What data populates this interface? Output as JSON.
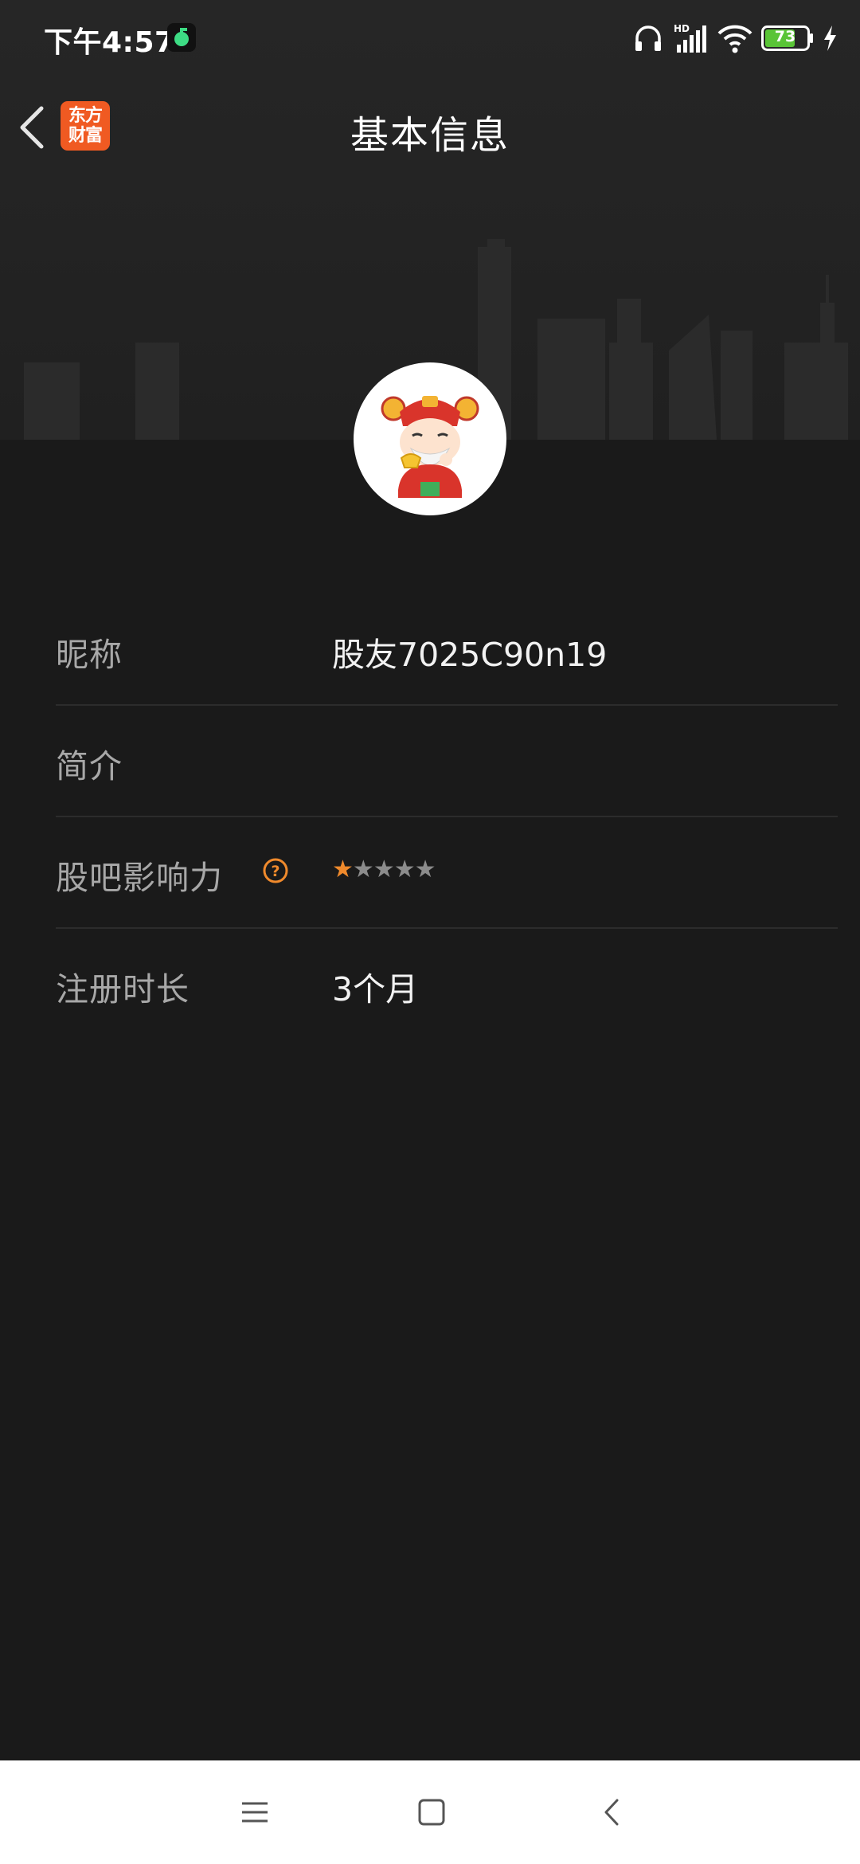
{
  "status_bar": {
    "time": "下午4:57",
    "battery": "73"
  },
  "header": {
    "title": "基本信息",
    "logo_text": "东方财富"
  },
  "profile": {
    "rows": [
      {
        "label": "昵称",
        "value": "股友7025C90n19"
      },
      {
        "label": "简介",
        "value": ""
      },
      {
        "label": "股吧影响力",
        "rating": 1,
        "rating_max": 5
      },
      {
        "label": "注册时长",
        "value": "3个月"
      }
    ]
  },
  "colors": {
    "accent": "#f08a2c",
    "logo_bg": "#f05a22",
    "background": "#1a1a1a"
  },
  "icons": [
    "back-arrow-icon",
    "help-icon",
    "menu-icon",
    "home-icon",
    "back-nav-icon",
    "headphones-icon",
    "signal-icon",
    "wifi-icon",
    "battery-icon",
    "charging-icon"
  ]
}
